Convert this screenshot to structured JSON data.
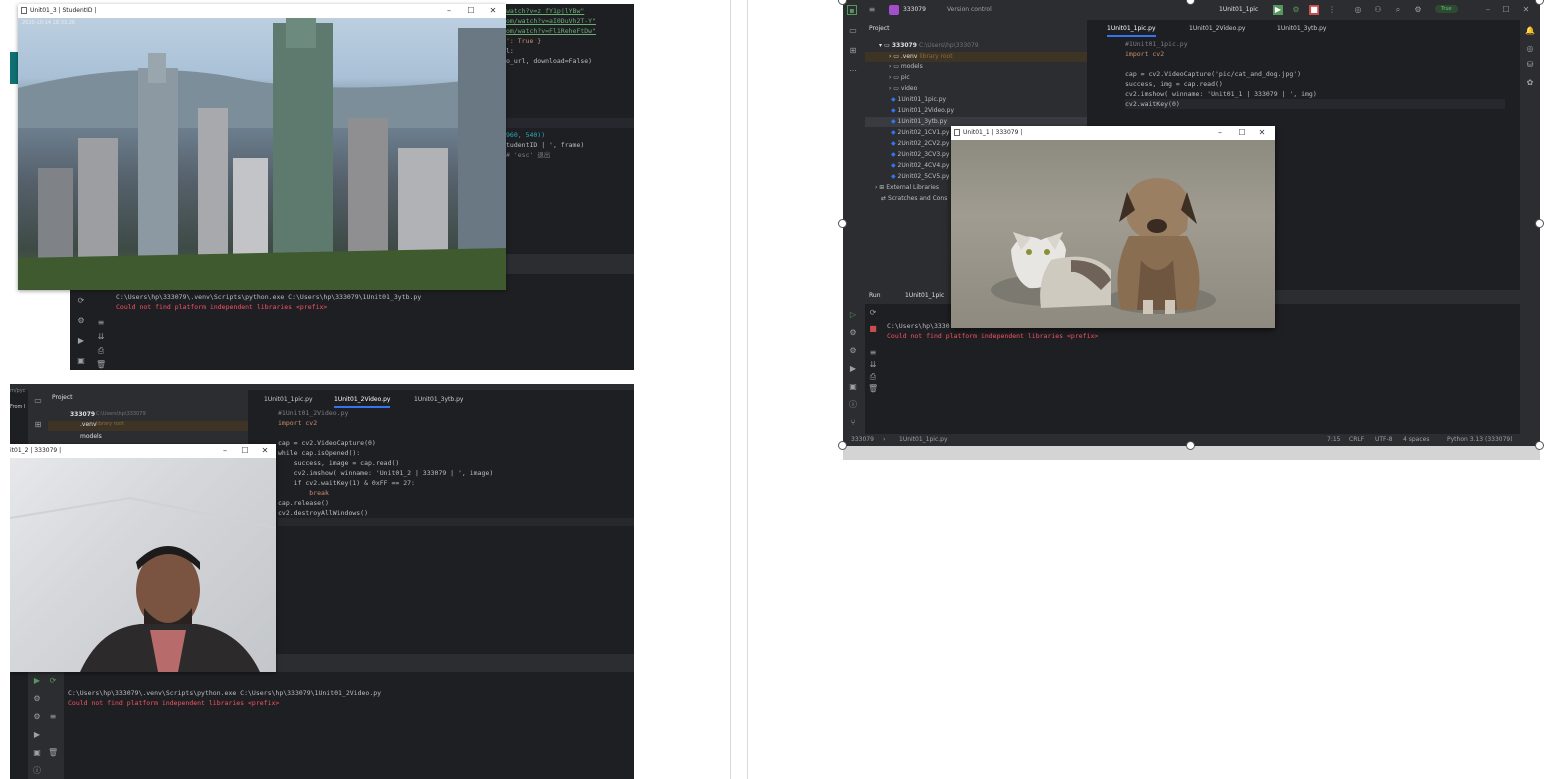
{
  "top_left": {
    "window_title": "Unit01_3 | StudentID |",
    "timestamp": "2020-10-14 18:33:26",
    "code_lines": [
      "watch?v=z_fY1pjlYBw\"",
      "om/watch?v=aI0DuVh2T-Y\"",
      "om/watch?v=Fl1ReheFtDw\"",
      "': True }",
      "l:",
      "o_url, download=False)",
      "960, 540))",
      "tudentID | ', frame)",
      "# 'esc' 退出"
    ],
    "console": [
      "C:\\Users\\hp\\333079\\.venv\\Scripts\\python.exe C:\\Users\\hp\\333079\\1Unit01_3ytb.py",
      "Could not find platform independent libraries <prefix>"
    ]
  },
  "bottom_left": {
    "left_snippet": "m/pyc",
    "from_label": "From I",
    "project_label": "Project",
    "project_root": "333079",
    "project_path": "C:\\Users\\hp\\333079",
    "venv_label": ".venv",
    "venv_note": "library root",
    "models_label": "models",
    "tabs": [
      "1Unit01_1pic.py",
      "1Unit01_2Video.py",
      "1Unit01_3ytb.py"
    ],
    "code_lines": [
      "#1Unit01_2Video.py",
      "import cv2",
      "",
      "cap = cv2.VideoCapture(0)",
      "while cap.isOpened():",
      "    success, image = cap.read()",
      "    cv2.imshow( winname: 'Unit01_2 | 333079 | ', image)",
      "    if cv2.waitKey(1) & 0xFF == 27:",
      "        break",
      "cap.release()",
      "cv2.destroyAllWindows()"
    ],
    "window_title": "it01_2 | 333079 |",
    "console": [
      "C:\\Users\\hp\\333079\\.venv\\Scripts\\python.exe C:\\Users\\hp\\333079\\1Unit01_2Video.py",
      "Could not find platform independent libraries <prefix>"
    ]
  },
  "right": {
    "project_name": "333079",
    "vcs_label": "Version control",
    "run_config": "1Unit01_1pic",
    "python_badge": "True",
    "project_label": "Project",
    "project_path": "C:\\Users\\hp\\333079",
    "tree": [
      {
        "label": "333079",
        "note": "C:\\Users\\hp\\333079"
      },
      {
        "label": ".venv",
        "note": "library root"
      },
      {
        "label": "models",
        "note": ""
      },
      {
        "label": "pic",
        "note": ""
      },
      {
        "label": "video",
        "note": ""
      },
      {
        "label": "1Unit01_1pic.py",
        "note": ""
      },
      {
        "label": "1Unit01_2Video.py",
        "note": ""
      },
      {
        "label": "1Unit01_3ytb.py",
        "note": ""
      },
      {
        "label": "2Unit02_1CV1.py",
        "note": ""
      },
      {
        "label": "2Unit02_2CV2.py",
        "note": ""
      },
      {
        "label": "2Unit02_3CV3.py",
        "note": ""
      },
      {
        "label": "2Unit02_4CV4.py",
        "note": ""
      },
      {
        "label": "2Unit02_5CV5.py",
        "note": ""
      },
      {
        "label": "External Libraries",
        "note": ""
      },
      {
        "label": "Scratches and Cons",
        "note": ""
      }
    ],
    "tabs": [
      "1Unit01_1pic.py",
      "1Unit01_2Video.py",
      "1Unit01_3ytb.py"
    ],
    "code_lines": [
      "#1Unit01_1pic.py",
      "import cv2",
      "",
      "cap = cv2.VideoCapture('pic/cat_and_dog.jpg')",
      "success, img = cap.read()",
      "cv2.imshow( winname: 'Unit01_1 | 333079 | ', img)",
      "cv2.waitKey(0)"
    ],
    "window_title": "Unit01_1 | 333079 |",
    "run_label": "Run",
    "run_tab": "1Unit01_1pic",
    "console": [
      "C:\\Users\\hp\\3330",
      "Could not find platform independent libraries <prefix>"
    ],
    "status": {
      "breadcrumb_root": "333079",
      "breadcrumb_file": "1Unit01_1pic.py",
      "position": "7:15",
      "line_ending": "CRLF",
      "encoding": "UTF-8",
      "indent": "4 spaces",
      "interpreter": "Python 3.13 (333079)"
    }
  }
}
